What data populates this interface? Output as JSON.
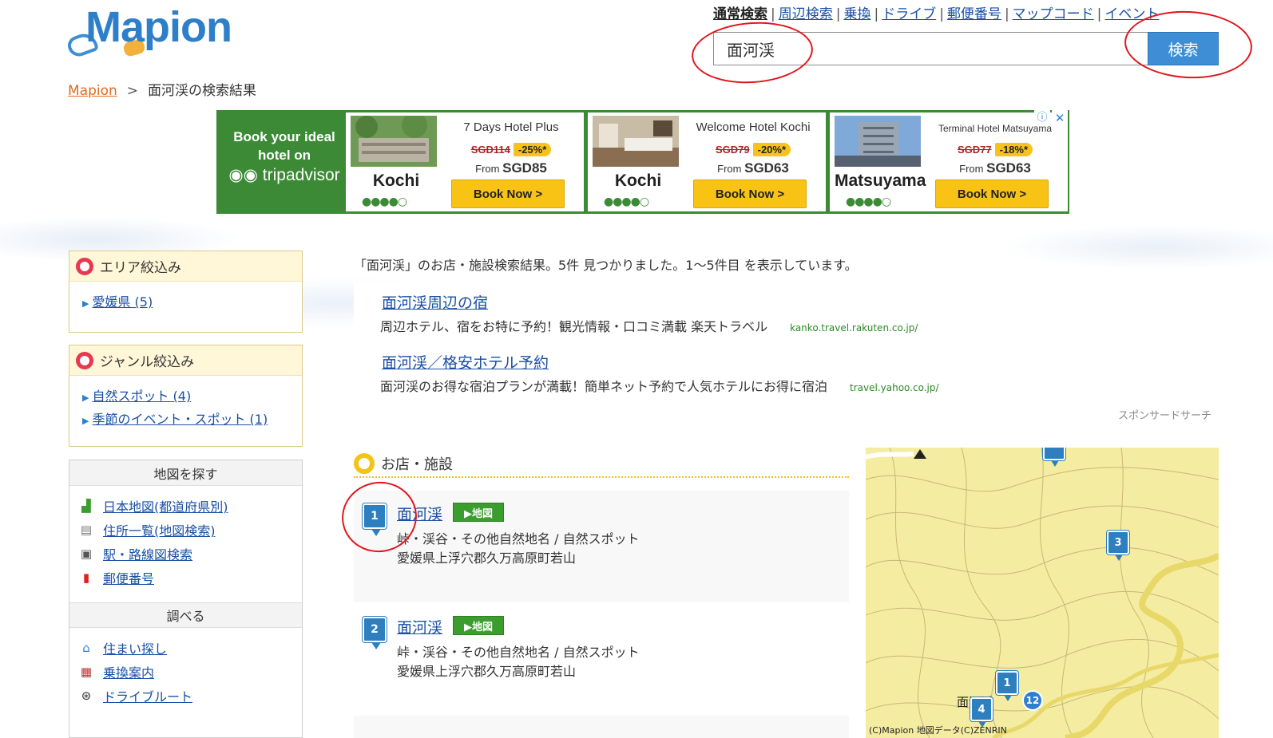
{
  "header": {
    "logo_text": "Mapion",
    "search_tabs": [
      {
        "label": "通常検索",
        "active": true
      },
      {
        "label": "周辺検索",
        "active": false
      },
      {
        "label": "乗換",
        "active": false
      },
      {
        "label": "ドライブ",
        "active": false
      },
      {
        "label": "郵便番号",
        "active": false
      },
      {
        "label": "マップコード",
        "active": false
      },
      {
        "label": "イベント",
        "active": false
      }
    ],
    "search_value": "面河渓",
    "search_button": "検索"
  },
  "breadcrumb": {
    "home": "Mapion",
    "current": "面河渓の検索結果"
  },
  "ad": {
    "brand_line1": "Book your ideal",
    "brand_line2": "hotel on",
    "brand_logo": "tripadvisor",
    "cards": [
      {
        "name": "7 Days Hotel Plus",
        "old_price": "SGD114",
        "discount": "-25%*",
        "from_label": "From",
        "price": "SGD85",
        "city": "Kochi",
        "rating": "●●●●○",
        "book": "Book Now >"
      },
      {
        "name": "Welcome Hotel Kochi",
        "old_price": "SGD79",
        "discount": "-20%*",
        "from_label": "From",
        "price": "SGD63",
        "city": "Kochi",
        "rating": "●●●●○",
        "book": "Book Now >"
      },
      {
        "name": "Terminal Hotel Matsuyama",
        "old_price": "SGD77",
        "discount": "-18%*",
        "from_label": "From",
        "price": "SGD63",
        "city": "Matsuyama",
        "rating": "●●●●○",
        "book": "Book Now >"
      }
    ],
    "info_icon": "ⓘ",
    "close_icon": "✕"
  },
  "sidebar": {
    "area": {
      "title": "エリア絞込み",
      "items": [
        "愛媛県 (5)"
      ]
    },
    "genre": {
      "title": "ジャンル絞込み",
      "items": [
        "自然スポット (4)",
        "季節のイベント・スポット (1)"
      ]
    },
    "find_map": {
      "title": "地図を探す",
      "items": [
        {
          "label": "日本地図(都道府県別)",
          "icon": "japan-map-icon"
        },
        {
          "label": "住所一覧(地図検索)",
          "icon": "address-book-icon"
        },
        {
          "label": "駅・路線図検索",
          "icon": "train-icon"
        },
        {
          "label": "郵便番号",
          "icon": "postbox-icon"
        }
      ]
    },
    "research": {
      "title": "調べる",
      "items": [
        {
          "label": "住まい探し",
          "icon": "house-icon"
        },
        {
          "label": "乗換案内",
          "icon": "railcar-icon"
        },
        {
          "label": "ドライブルート",
          "icon": "steering-wheel-icon"
        }
      ]
    }
  },
  "main": {
    "summary": "「面河渓」のお店・施設検索結果。5件 見つかりました。1〜5件目 を表示しています。",
    "sponsored": [
      {
        "title": "面河渓周辺の宿",
        "desc": "周辺ホテル、宿をお特に予約！観光情報・口コミ満載 楽天トラベル",
        "url": "kanko.travel.rakuten.co.jp/"
      },
      {
        "title": "面河渓／格安ホテル予約",
        "desc": "面河渓のお得な宿泊プランが満載！簡単ネット予約で人気ホテルにお得に宿泊",
        "url": "travel.yahoo.co.jp/"
      }
    ],
    "sponsored_label": "スポンサードサーチ",
    "section_title": "お店・施設",
    "results": [
      {
        "num": "1",
        "name": "面河渓",
        "map_label": "▶地図",
        "category": "峠・渓谷・その他自然地名 / 自然スポット",
        "address": "愛媛県上浮穴郡久万高原町若山"
      },
      {
        "num": "2",
        "name": "面河渓",
        "map_label": "▶地図",
        "category": "峠・渓谷・その他自然地名 / 自然スポット",
        "address": "愛媛県上浮穴郡久万高原町若山"
      }
    ]
  },
  "map": {
    "pins": [
      "3",
      "1",
      "4"
    ],
    "route_number": "12",
    "place_label": "面河渓",
    "copyright": "(C)Mapion 地図データ(C)ZENRIN"
  },
  "colors": {
    "accent_blue": "#3d8ed5",
    "tripadvisor_green": "#3c8a36",
    "book_yellow": "#f9c315",
    "annotation_red": "#e0161c"
  }
}
